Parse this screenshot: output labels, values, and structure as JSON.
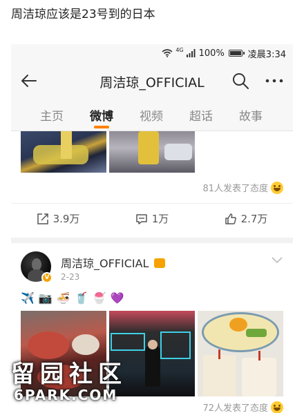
{
  "post_title": "周洁琼应该是23号到的日本",
  "status_bar": {
    "signal_label": "4G",
    "battery": "100%",
    "time": "凌晨3:34"
  },
  "nav": {
    "title": "周洁琼_OFFICIAL",
    "back_icon": "back-arrow-icon",
    "search_icon": "search-icon",
    "more_icon": "more-icon"
  },
  "tabs": [
    {
      "label": "主页",
      "active": false
    },
    {
      "label": "微博",
      "active": true
    },
    {
      "label": "视频",
      "active": false
    },
    {
      "label": "超话",
      "active": false
    },
    {
      "label": "故事",
      "active": false
    }
  ],
  "accent_color": "#ff8200",
  "post1": {
    "reaction_text": "81人发表了态度",
    "actions": {
      "repost": "3.9万",
      "comment": "1万",
      "like": "2.7万"
    }
  },
  "post2": {
    "user": "周洁琼_OFFICIAL",
    "verified": "V",
    "date": "2-23",
    "emojis": [
      "✈️",
      "📷",
      "🍜",
      "🥤",
      "🍧",
      "💜"
    ],
    "reaction_text": "72人发表了态度"
  },
  "watermark": {
    "line1": "留园社区",
    "line2": "6PARK.COM"
  }
}
